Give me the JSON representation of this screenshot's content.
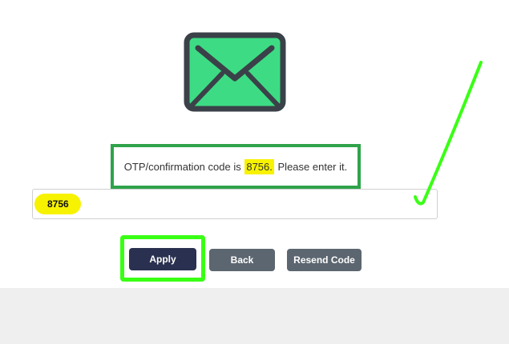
{
  "message": {
    "prefix": "OTP/confirmation code is",
    "code": "8756.",
    "suffix": "Please enter it."
  },
  "otp_input": {
    "value": "8756"
  },
  "buttons": {
    "apply_label": "Apply",
    "back_label": "Back",
    "resend_label": "Resend Code"
  },
  "icons": {
    "envelope": "envelope-icon",
    "check": "checkmark-annotation"
  },
  "colors": {
    "envelope_fill": "#3ddc84",
    "envelope_stroke": "#3b4148",
    "message_border": "#2fa34a",
    "highlight": "#f7f200",
    "annotation_green": "#39ff14",
    "apply_bg": "#2a3150",
    "secondary_bg": "#5c6670",
    "footer_bg": "#efefef"
  }
}
